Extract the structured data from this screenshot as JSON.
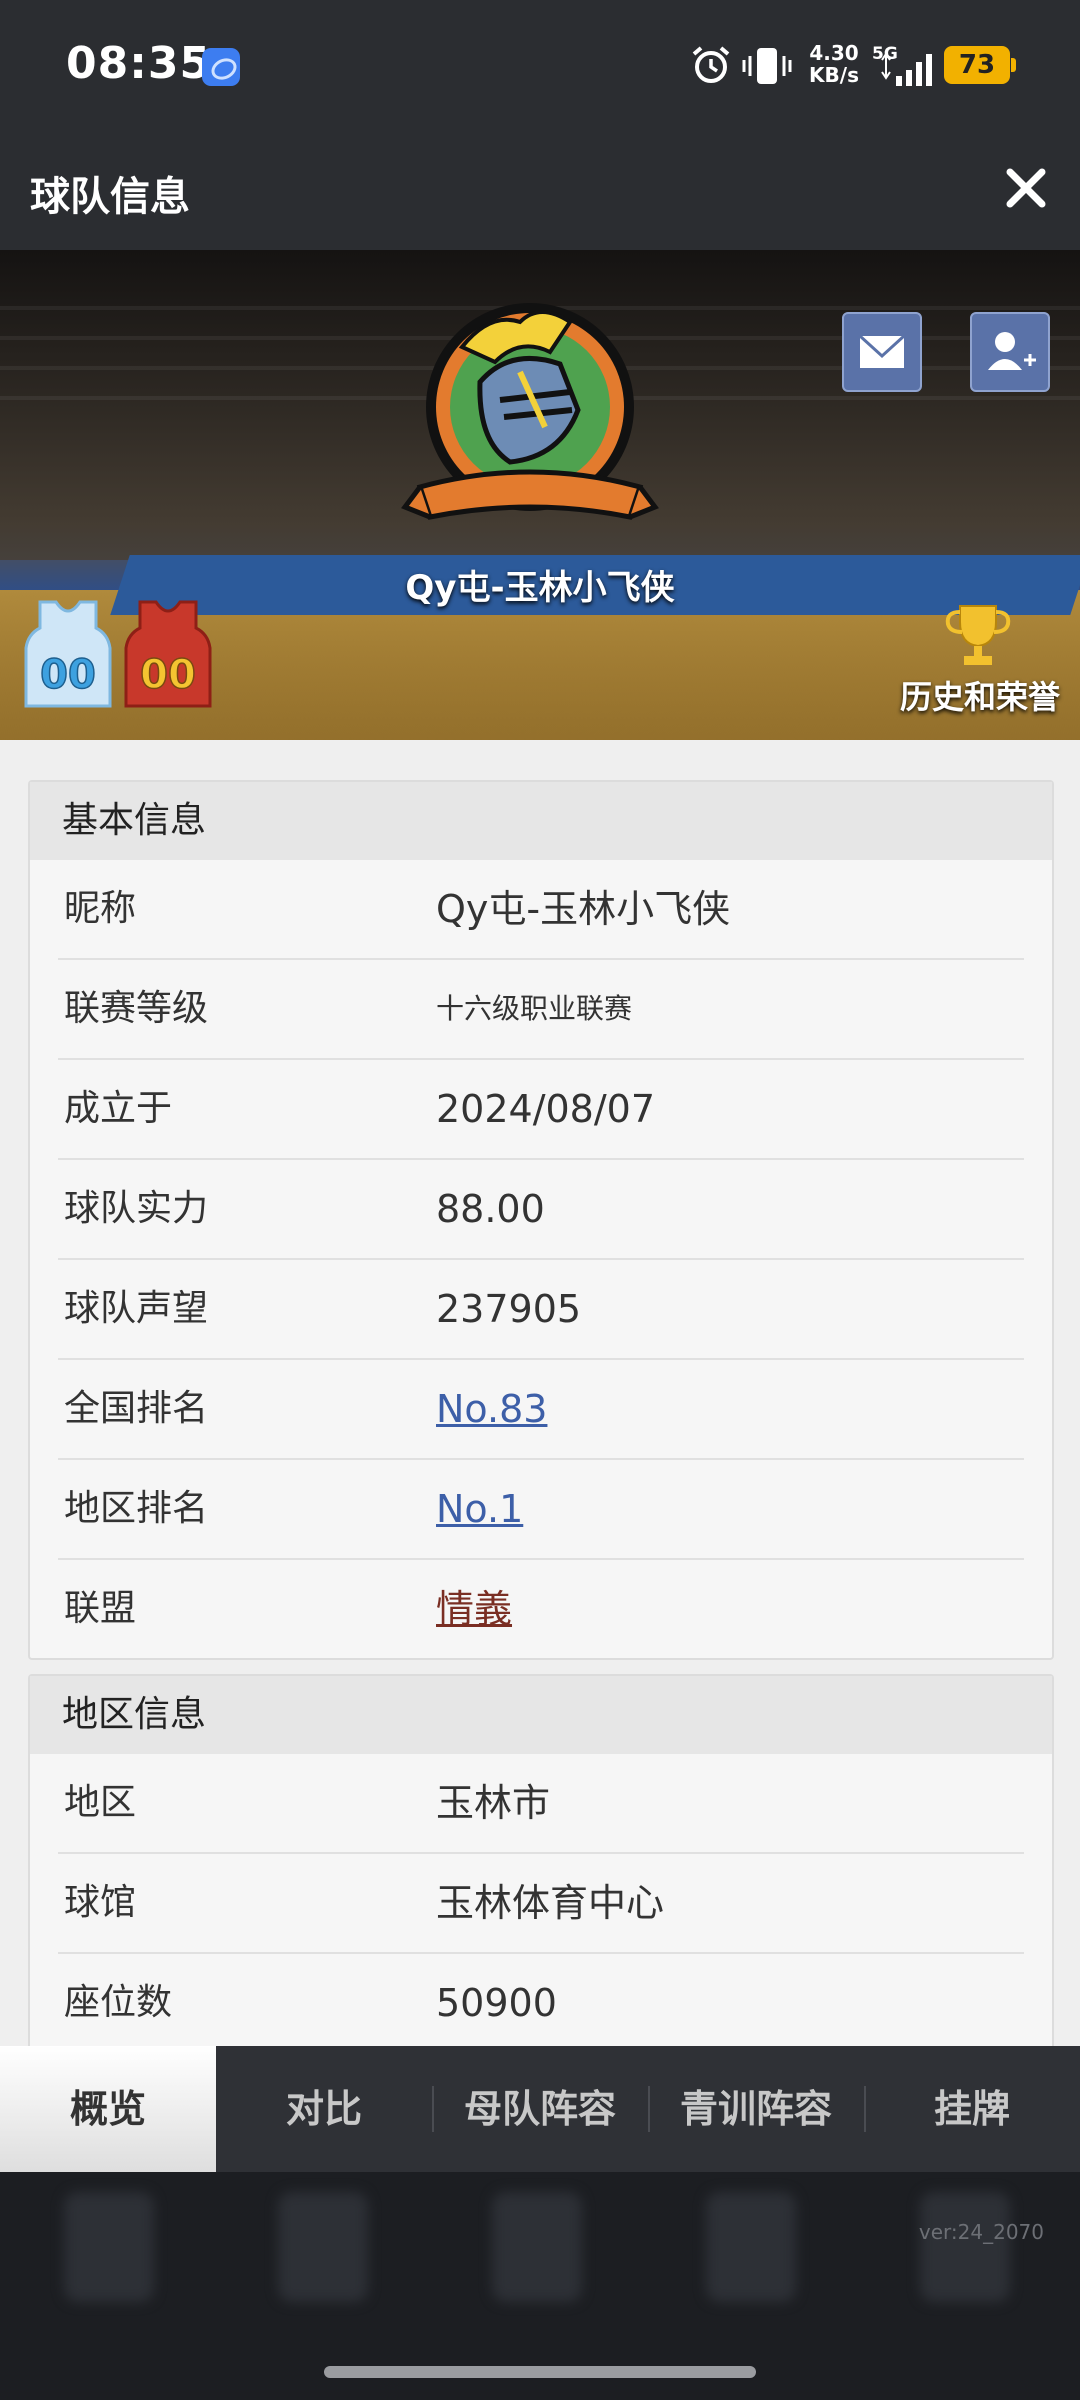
{
  "status_bar": {
    "time": "08:35",
    "net_speed_value": "4.30",
    "net_speed_unit": "KB/s",
    "network_type": "5G",
    "battery": "73",
    "icons": [
      "app-icon",
      "alarm-icon",
      "vibrate-icon",
      "signal-icon",
      "battery-icon"
    ]
  },
  "header": {
    "title": "球队信息",
    "close_icon": "close-icon"
  },
  "banner": {
    "team_name": "Qy屯-玉林小飞侠",
    "history_label": "历史和荣誉",
    "jersey_home_number": "00",
    "jersey_away_number": "00",
    "icons": [
      "mail-icon",
      "add-friend-icon",
      "trophy-icon",
      "team-logo"
    ]
  },
  "basic_info": {
    "title": "基本信息",
    "rows": [
      {
        "label": "昵称",
        "value": "Qy屯-玉林小飞侠"
      },
      {
        "label": "联赛等级",
        "value": "十六级职业联赛"
      },
      {
        "label": "成立于",
        "value": "2024/08/07"
      },
      {
        "label": "球队实力",
        "value": "88.00"
      },
      {
        "label": "球队声望",
        "value": "237905"
      },
      {
        "label": "全国排名",
        "value": "No.83"
      },
      {
        "label": "地区排名",
        "value": "No.1"
      },
      {
        "label": "联盟",
        "value": "情義"
      }
    ]
  },
  "region_info": {
    "title": "地区信息",
    "rows": [
      {
        "label": "地区",
        "value": "玉林市"
      },
      {
        "label": "球馆",
        "value": "玉林体育中心"
      },
      {
        "label": "座位数",
        "value": "50900"
      }
    ]
  },
  "tabs": [
    {
      "label": "概览",
      "active": true
    },
    {
      "label": "对比",
      "active": false
    },
    {
      "label": "母队阵容",
      "active": false
    },
    {
      "label": "青训阵容",
      "active": false
    },
    {
      "label": "挂牌",
      "active": false
    }
  ],
  "version": "ver:24_2070",
  "colors": {
    "link_blue": "#3d5fa8",
    "link_brown": "#7a2e23",
    "battery": "#f2b100",
    "header_bg": "#2b2d31"
  }
}
